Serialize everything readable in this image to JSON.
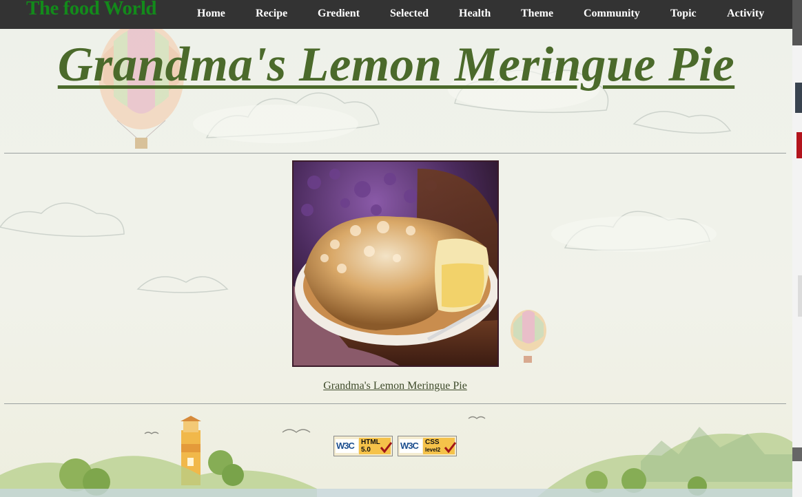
{
  "nav": {
    "logo": "The food World",
    "links": [
      {
        "label": "Home"
      },
      {
        "label": "Recipe"
      },
      {
        "label": "Gredient"
      },
      {
        "label": "Selected"
      },
      {
        "label": "Health"
      },
      {
        "label": "Theme"
      },
      {
        "label": "Community"
      },
      {
        "label": "Topic"
      },
      {
        "label": "Activity"
      }
    ]
  },
  "page": {
    "title": "Grandma's Lemon Meringue Pie",
    "caption": "Grandma's Lemon Meringue Pie"
  },
  "badges": [
    {
      "w3": "W3C",
      "line1": "HTML",
      "line2": "5.0"
    },
    {
      "w3": "W3C",
      "line1": "CSS",
      "line2": "level2"
    }
  ],
  "colors": {
    "navbar": "#333333",
    "logo": "#138a1b",
    "title": "#4b6a2b"
  }
}
